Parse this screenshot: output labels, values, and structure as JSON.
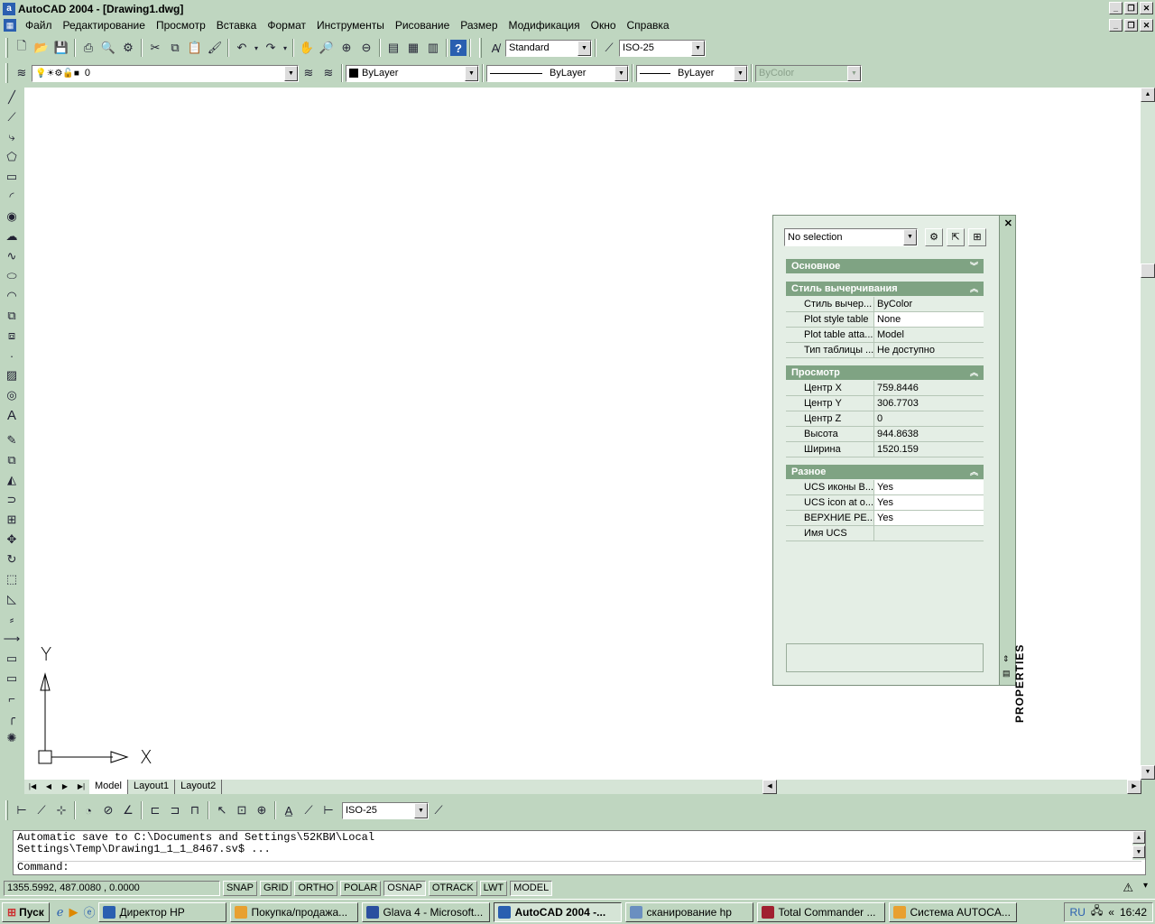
{
  "window": {
    "title": "AutoCAD 2004 - [Drawing1.dwg]"
  },
  "menu": {
    "items": [
      "Файл",
      "Редактирование",
      "Просмотр",
      "Вставка",
      "Формат",
      "Инструменты",
      "Рисование",
      "Размер",
      "Модификация",
      "Окно",
      "Справка"
    ]
  },
  "toolbar": {
    "text_style": "Standard",
    "dim_style": "ISO-25"
  },
  "layers": {
    "current": "0",
    "color": "ByLayer",
    "linetype": "ByLayer",
    "lineweight": "ByLayer",
    "plotstyle": "ByColor"
  },
  "ucs": {
    "x_label": "X",
    "y_label": "Y"
  },
  "layout_tabs": [
    "Model",
    "Layout1",
    "Layout2"
  ],
  "dim_toolbar": {
    "dim_style": "ISO-25"
  },
  "command": {
    "line1": "Automatic save to C:\\Documents and Settings\\52КВИ\\Local",
    "line2": "Settings\\Temp\\Drawing1_1_1_8467.sv$ ...",
    "prompt": "Command:"
  },
  "status": {
    "coords": "1355.5992, 487.0080 , 0.0000",
    "toggles": [
      "SNAP",
      "GRID",
      "ORTHO",
      "POLAR",
      "OSNAP",
      "OTRACK",
      "LWT",
      "MODEL"
    ],
    "on": [
      false,
      false,
      false,
      false,
      true,
      false,
      false,
      true
    ]
  },
  "properties": {
    "selection": "No selection",
    "palette_label": "PROPERTIES",
    "categories": {
      "general": "Основное",
      "plotstyle": "Стиль вычерчивания",
      "view": "Просмотр",
      "misc": "Разное"
    },
    "plotstyle_rows": [
      {
        "name": "Стиль вычер...",
        "value": "ByColor"
      },
      {
        "name": "Plot style table",
        "value": "None"
      },
      {
        "name": "Plot table atta...",
        "value": "Model"
      },
      {
        "name": "Тип таблицы ...",
        "value": "Не доступно"
      }
    ],
    "view_rows": [
      {
        "name": "Центр X",
        "value": "759.8446"
      },
      {
        "name": "Центр Y",
        "value": "306.7703"
      },
      {
        "name": "Центр Z",
        "value": "0"
      },
      {
        "name": "Высота",
        "value": "944.8638"
      },
      {
        "name": "Ширина",
        "value": "1520.159"
      }
    ],
    "misc_rows": [
      {
        "name": "UCS иконы В...",
        "value": "Yes"
      },
      {
        "name": "UCS icon at o...",
        "value": "Yes"
      },
      {
        "name": "ВЕРХНИЕ РЕ...",
        "value": "Yes"
      },
      {
        "name": "Имя UCS",
        "value": ""
      }
    ]
  },
  "taskbar": {
    "start": "Пуск",
    "tasks": [
      "Директор HP",
      "Покупка/продажа...",
      "Glava 4 - Microsoft...",
      "AutoCAD 2004 -...",
      "сканирование hp",
      "Total Commander ...",
      "Система AUTOCA..."
    ],
    "lang": "RU",
    "clock": "16:42"
  }
}
